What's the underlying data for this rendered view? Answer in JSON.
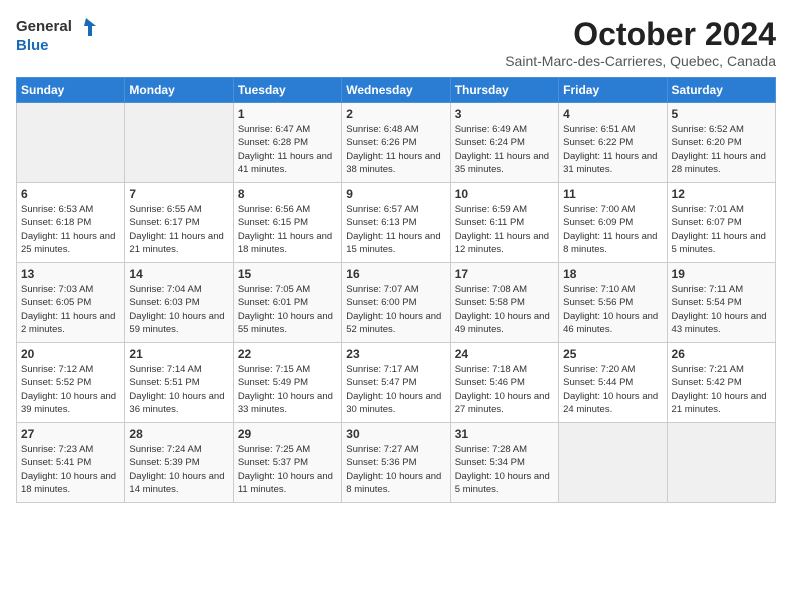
{
  "header": {
    "logo_general": "General",
    "logo_blue": "Blue",
    "month": "October 2024",
    "location": "Saint-Marc-des-Carrieres, Quebec, Canada"
  },
  "weekdays": [
    "Sunday",
    "Monday",
    "Tuesday",
    "Wednesday",
    "Thursday",
    "Friday",
    "Saturday"
  ],
  "weeks": [
    [
      {
        "day": "",
        "sunrise": "",
        "sunset": "",
        "daylight": ""
      },
      {
        "day": "",
        "sunrise": "",
        "sunset": "",
        "daylight": ""
      },
      {
        "day": "1",
        "sunrise": "Sunrise: 6:47 AM",
        "sunset": "Sunset: 6:28 PM",
        "daylight": "Daylight: 11 hours and 41 minutes."
      },
      {
        "day": "2",
        "sunrise": "Sunrise: 6:48 AM",
        "sunset": "Sunset: 6:26 PM",
        "daylight": "Daylight: 11 hours and 38 minutes."
      },
      {
        "day": "3",
        "sunrise": "Sunrise: 6:49 AM",
        "sunset": "Sunset: 6:24 PM",
        "daylight": "Daylight: 11 hours and 35 minutes."
      },
      {
        "day": "4",
        "sunrise": "Sunrise: 6:51 AM",
        "sunset": "Sunset: 6:22 PM",
        "daylight": "Daylight: 11 hours and 31 minutes."
      },
      {
        "day": "5",
        "sunrise": "Sunrise: 6:52 AM",
        "sunset": "Sunset: 6:20 PM",
        "daylight": "Daylight: 11 hours and 28 minutes."
      }
    ],
    [
      {
        "day": "6",
        "sunrise": "Sunrise: 6:53 AM",
        "sunset": "Sunset: 6:18 PM",
        "daylight": "Daylight: 11 hours and 25 minutes."
      },
      {
        "day": "7",
        "sunrise": "Sunrise: 6:55 AM",
        "sunset": "Sunset: 6:17 PM",
        "daylight": "Daylight: 11 hours and 21 minutes."
      },
      {
        "day": "8",
        "sunrise": "Sunrise: 6:56 AM",
        "sunset": "Sunset: 6:15 PM",
        "daylight": "Daylight: 11 hours and 18 minutes."
      },
      {
        "day": "9",
        "sunrise": "Sunrise: 6:57 AM",
        "sunset": "Sunset: 6:13 PM",
        "daylight": "Daylight: 11 hours and 15 minutes."
      },
      {
        "day": "10",
        "sunrise": "Sunrise: 6:59 AM",
        "sunset": "Sunset: 6:11 PM",
        "daylight": "Daylight: 11 hours and 12 minutes."
      },
      {
        "day": "11",
        "sunrise": "Sunrise: 7:00 AM",
        "sunset": "Sunset: 6:09 PM",
        "daylight": "Daylight: 11 hours and 8 minutes."
      },
      {
        "day": "12",
        "sunrise": "Sunrise: 7:01 AM",
        "sunset": "Sunset: 6:07 PM",
        "daylight": "Daylight: 11 hours and 5 minutes."
      }
    ],
    [
      {
        "day": "13",
        "sunrise": "Sunrise: 7:03 AM",
        "sunset": "Sunset: 6:05 PM",
        "daylight": "Daylight: 11 hours and 2 minutes."
      },
      {
        "day": "14",
        "sunrise": "Sunrise: 7:04 AM",
        "sunset": "Sunset: 6:03 PM",
        "daylight": "Daylight: 10 hours and 59 minutes."
      },
      {
        "day": "15",
        "sunrise": "Sunrise: 7:05 AM",
        "sunset": "Sunset: 6:01 PM",
        "daylight": "Daylight: 10 hours and 55 minutes."
      },
      {
        "day": "16",
        "sunrise": "Sunrise: 7:07 AM",
        "sunset": "Sunset: 6:00 PM",
        "daylight": "Daylight: 10 hours and 52 minutes."
      },
      {
        "day": "17",
        "sunrise": "Sunrise: 7:08 AM",
        "sunset": "Sunset: 5:58 PM",
        "daylight": "Daylight: 10 hours and 49 minutes."
      },
      {
        "day": "18",
        "sunrise": "Sunrise: 7:10 AM",
        "sunset": "Sunset: 5:56 PM",
        "daylight": "Daylight: 10 hours and 46 minutes."
      },
      {
        "day": "19",
        "sunrise": "Sunrise: 7:11 AM",
        "sunset": "Sunset: 5:54 PM",
        "daylight": "Daylight: 10 hours and 43 minutes."
      }
    ],
    [
      {
        "day": "20",
        "sunrise": "Sunrise: 7:12 AM",
        "sunset": "Sunset: 5:52 PM",
        "daylight": "Daylight: 10 hours and 39 minutes."
      },
      {
        "day": "21",
        "sunrise": "Sunrise: 7:14 AM",
        "sunset": "Sunset: 5:51 PM",
        "daylight": "Daylight: 10 hours and 36 minutes."
      },
      {
        "day": "22",
        "sunrise": "Sunrise: 7:15 AM",
        "sunset": "Sunset: 5:49 PM",
        "daylight": "Daylight: 10 hours and 33 minutes."
      },
      {
        "day": "23",
        "sunrise": "Sunrise: 7:17 AM",
        "sunset": "Sunset: 5:47 PM",
        "daylight": "Daylight: 10 hours and 30 minutes."
      },
      {
        "day": "24",
        "sunrise": "Sunrise: 7:18 AM",
        "sunset": "Sunset: 5:46 PM",
        "daylight": "Daylight: 10 hours and 27 minutes."
      },
      {
        "day": "25",
        "sunrise": "Sunrise: 7:20 AM",
        "sunset": "Sunset: 5:44 PM",
        "daylight": "Daylight: 10 hours and 24 minutes."
      },
      {
        "day": "26",
        "sunrise": "Sunrise: 7:21 AM",
        "sunset": "Sunset: 5:42 PM",
        "daylight": "Daylight: 10 hours and 21 minutes."
      }
    ],
    [
      {
        "day": "27",
        "sunrise": "Sunrise: 7:23 AM",
        "sunset": "Sunset: 5:41 PM",
        "daylight": "Daylight: 10 hours and 18 minutes."
      },
      {
        "day": "28",
        "sunrise": "Sunrise: 7:24 AM",
        "sunset": "Sunset: 5:39 PM",
        "daylight": "Daylight: 10 hours and 14 minutes."
      },
      {
        "day": "29",
        "sunrise": "Sunrise: 7:25 AM",
        "sunset": "Sunset: 5:37 PM",
        "daylight": "Daylight: 10 hours and 11 minutes."
      },
      {
        "day": "30",
        "sunrise": "Sunrise: 7:27 AM",
        "sunset": "Sunset: 5:36 PM",
        "daylight": "Daylight: 10 hours and 8 minutes."
      },
      {
        "day": "31",
        "sunrise": "Sunrise: 7:28 AM",
        "sunset": "Sunset: 5:34 PM",
        "daylight": "Daylight: 10 hours and 5 minutes."
      },
      {
        "day": "",
        "sunrise": "",
        "sunset": "",
        "daylight": ""
      },
      {
        "day": "",
        "sunrise": "",
        "sunset": "",
        "daylight": ""
      }
    ]
  ]
}
